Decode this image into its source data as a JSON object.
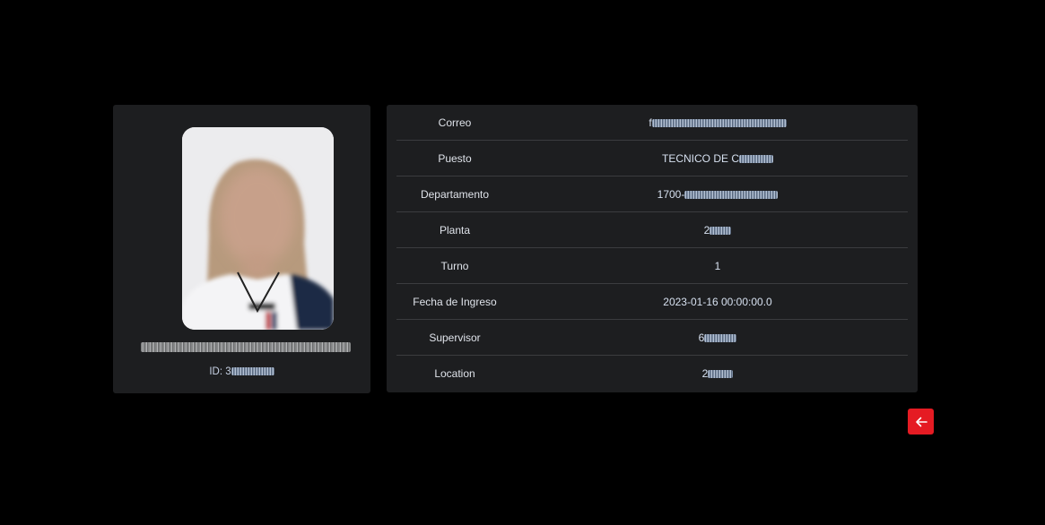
{
  "profile": {
    "id_label": "ID: 3"
  },
  "details": [
    {
      "label": "Correo",
      "value": "f"
    },
    {
      "label": "Puesto",
      "value": "TECNICO DE C"
    },
    {
      "label": "Departamento",
      "value": "1700-"
    },
    {
      "label": "Planta",
      "value": "2"
    },
    {
      "label": "Turno",
      "value": "1"
    },
    {
      "label": "Fecha de Ingreso",
      "value": "2023-01-16 00:00:00.0"
    },
    {
      "label": "Supervisor",
      "value": "6"
    },
    {
      "label": "Location",
      "value": "2"
    }
  ],
  "icons": {
    "back": "arrow-left-icon"
  },
  "colors": {
    "background": "#000000",
    "card": "#1d1e20",
    "accent": "#e51b23"
  }
}
